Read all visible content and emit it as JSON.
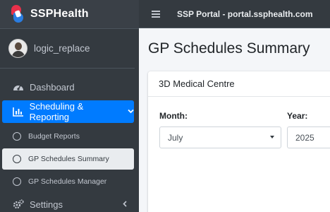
{
  "brand": {
    "name": "SSPHealth"
  },
  "user": {
    "name": "logic_replace"
  },
  "sidebar": {
    "items": [
      {
        "label": "Dashboard",
        "icon": "tachometer-icon"
      },
      {
        "label": "Scheduling & Reporting",
        "icon": "bar-chart-icon",
        "active": true
      },
      {
        "label": "Budget Reports",
        "icon": "circle-icon"
      },
      {
        "label": "GP Schedules Summary",
        "icon": "circle-icon",
        "current": true
      },
      {
        "label": "GP Schedules Manager",
        "icon": "circle-icon"
      },
      {
        "label": "Settings",
        "icon": "gears-icon"
      }
    ]
  },
  "topbar": {
    "title": "SSP Portal - portal.ssphealth.com"
  },
  "main": {
    "page_title": "GP Schedules Summary",
    "card_title": "3D Medical Centre",
    "month": {
      "label": "Month:",
      "value": "July"
    },
    "year": {
      "label": "Year:",
      "value": "2025"
    }
  },
  "colors": {
    "sidebar_bg": "#343a40",
    "active_blue": "#007bff",
    "brand_red": "#e8304a",
    "brand_blue": "#2a7de1"
  }
}
